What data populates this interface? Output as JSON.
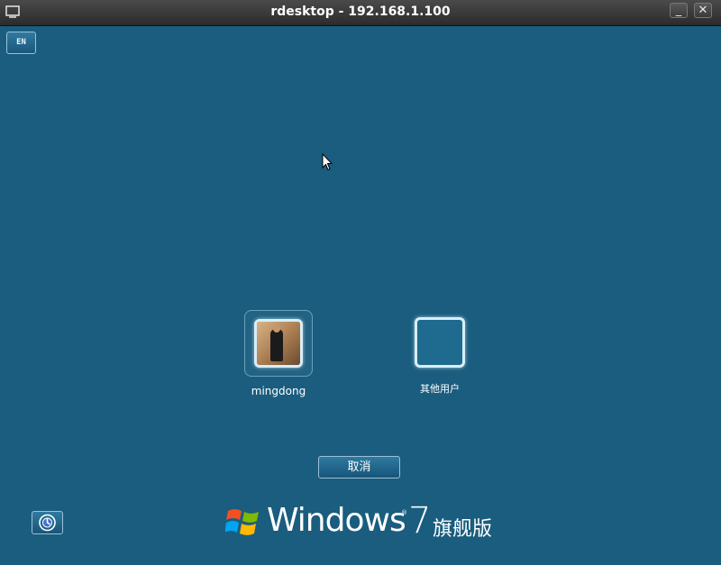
{
  "window": {
    "title": "rdesktop - 192.168.1.100",
    "minimize_glyph": "_",
    "close_glyph": "✕"
  },
  "language_button": {
    "label": "EN"
  },
  "users": [
    {
      "name": "mingdong",
      "icon": "user-photo"
    },
    {
      "name": "其他用户",
      "icon": "blank-user-tile"
    }
  ],
  "cancel_button": {
    "label": "取消"
  },
  "ease_of_access_icon": "ease-of-access-icon",
  "branding": {
    "product": "Windows",
    "registered": "®",
    "version": "7",
    "edition": "旗舰版"
  },
  "colors": {
    "background": "#1a5d7e",
    "titlebar": "#3a3a3a",
    "button": "#2a6f94",
    "text": "#ffffff"
  }
}
